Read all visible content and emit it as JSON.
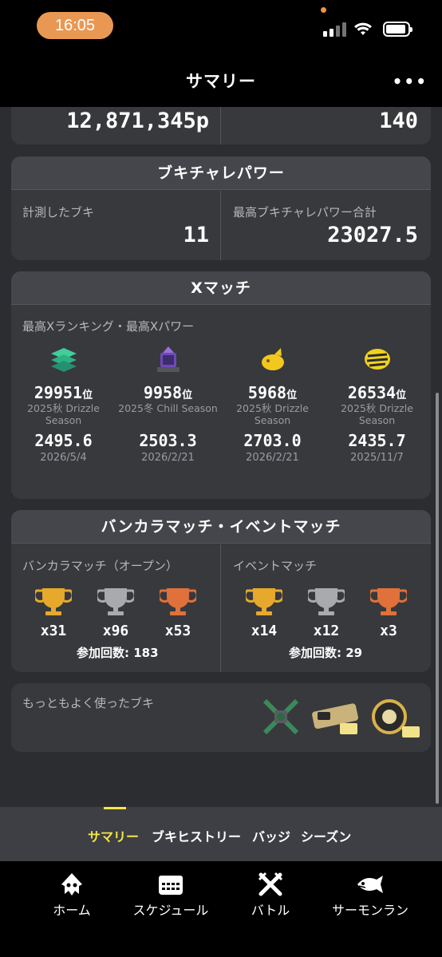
{
  "status": {
    "time": "16:05"
  },
  "nav": {
    "title": "サマリー",
    "more": "•••"
  },
  "top_values": {
    "points": "12,871,345p",
    "count": "140"
  },
  "buki_power": {
    "title": "ブキチャレパワー",
    "measured_label": "計測したブキ",
    "measured_value": "11",
    "max_label": "最高ブキチャレパワー合計",
    "max_value": "23027.5"
  },
  "xmatch": {
    "title": "Xマッチ",
    "subtitle": "最高Xランキング・最高Xパワー",
    "rank_suffix": "位",
    "columns": [
      {
        "icon": "splat-zones-icon",
        "rank": "29951",
        "season": "2025秋 Drizzle Season",
        "power": "2495.6",
        "date": "2026/5/4"
      },
      {
        "icon": "tower-control-icon",
        "rank": "9958",
        "season": "2025冬 Chill Season",
        "power": "2503.3",
        "date": "2026/2/21"
      },
      {
        "icon": "rainmaker-icon",
        "rank": "5968",
        "season": "2025秋 Drizzle Season",
        "power": "2703.0",
        "date": "2026/2/21"
      },
      {
        "icon": "clam-blitz-icon",
        "rank": "26534",
        "season": "2025秋 Drizzle Season",
        "power": "2435.7",
        "date": "2025/11/7"
      }
    ]
  },
  "bankara": {
    "title": "バンカラマッチ・イベントマッチ",
    "open_label": "バンカラマッチ（オープン）",
    "event_label": "イベントマッチ",
    "open_trophies": [
      {
        "type": "gold",
        "count": "x31",
        "color": "#e7a92c"
      },
      {
        "type": "silver",
        "count": "x96",
        "color": "#a9aaae"
      },
      {
        "type": "bronze",
        "count": "x53",
        "color": "#e0713a"
      }
    ],
    "event_trophies": [
      {
        "type": "gold",
        "count": "x14",
        "color": "#e7a92c"
      },
      {
        "type": "silver",
        "count": "x12",
        "color": "#a9aaae"
      },
      {
        "type": "bronze",
        "count": "x3",
        "color": "#e0713a"
      }
    ],
    "open_join": "参加回数: 183",
    "event_join": "参加回数: 29"
  },
  "most_used": {
    "label": "もっともよく使ったブキ"
  },
  "tabs": {
    "summary": "サマリー",
    "history": "ブキヒストリー",
    "badge": "バッジ",
    "season": "シーズン",
    "accent": "#f5e642"
  },
  "bottom_nav": {
    "home": "ホーム",
    "schedule": "スケジュール",
    "battle": "バトル",
    "salmon": "サーモンラン"
  }
}
